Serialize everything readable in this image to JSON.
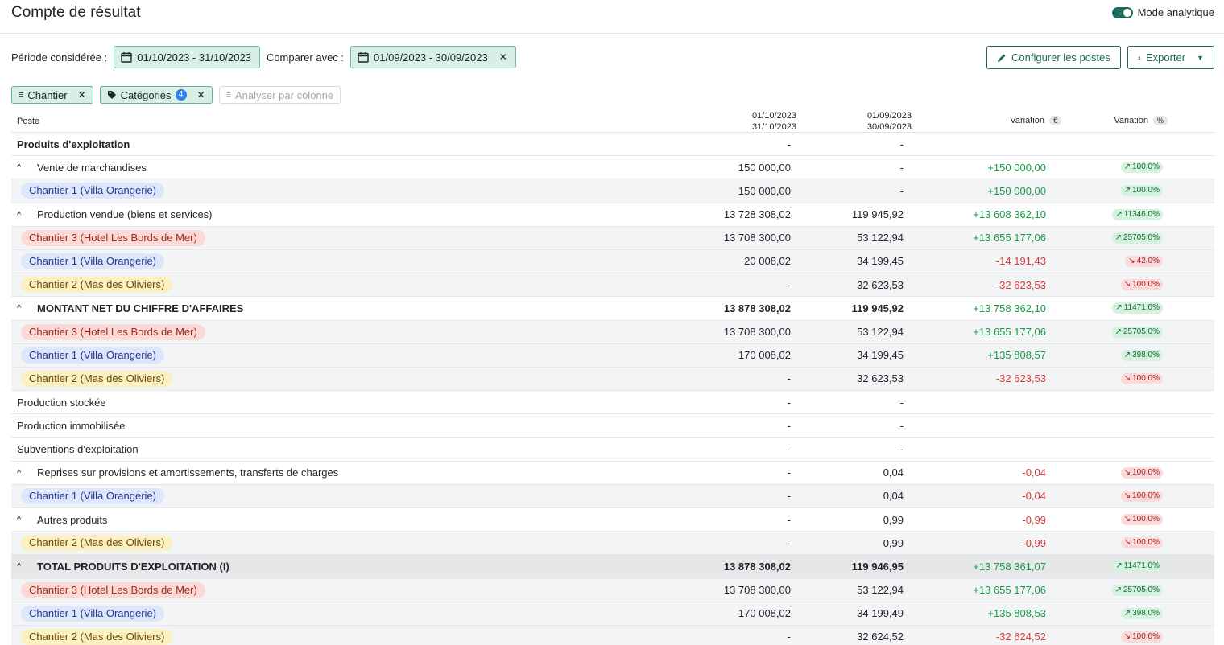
{
  "header": {
    "title": "Compte de résultat",
    "mode_label": "Mode analytique"
  },
  "filters": {
    "period_label": "Période considérée :",
    "period_value": "01/10/2023 - 31/10/2023",
    "compare_label": "Comparer avec :",
    "compare_value": "01/09/2023 - 30/09/2023"
  },
  "actions": {
    "configure_label": "Configurer les postes",
    "export_label": "Exporter"
  },
  "tags": {
    "chantier": "Chantier",
    "categories": "Catégories",
    "categories_count": "4",
    "analyse": "Analyser par colonne"
  },
  "table": {
    "headers": {
      "poste": "Poste",
      "d1_start": "01/10/2023",
      "d1_end": "31/10/2023",
      "d2_start": "01/09/2023",
      "d2_end": "30/09/2023",
      "variation": "Variation",
      "variation_unit": "€",
      "variation_pct": "Variation",
      "variation_pct_unit": "%"
    },
    "rows": [
      {
        "type": "section",
        "name": "Produits d'exploitation",
        "v1": "-",
        "v2": "-",
        "v3": "",
        "v4": ""
      },
      {
        "type": "group",
        "name": "Vente de marchandises",
        "v1": "150 000,00",
        "v2": "-",
        "v3": "+150 000,00",
        "v4": "100,0%",
        "dir": "up"
      },
      {
        "type": "sub",
        "chip": "c1",
        "name": "Chantier 1 (Villa Orangerie)",
        "v1": "150 000,00",
        "v2": "-",
        "v3": "+150 000,00",
        "v4": "100,0%",
        "dir": "up"
      },
      {
        "type": "group",
        "name": "Production vendue (biens et services)",
        "v1": "13 728 308,02",
        "v2": "119 945,92",
        "v3": "+13 608 362,10",
        "v4": "11346,0%",
        "dir": "up"
      },
      {
        "type": "sub",
        "chip": "c3",
        "name": "Chantier 3 (Hotel Les Bords de Mer)",
        "v1": "13 708 300,00",
        "v2": "53 122,94",
        "v3": "+13 655 177,06",
        "v4": "25705,0%",
        "dir": "up"
      },
      {
        "type": "sub",
        "chip": "c1",
        "name": "Chantier 1 (Villa Orangerie)",
        "v1": "20 008,02",
        "v2": "34 199,45",
        "v3": "-14 191,43",
        "v4": "42,0%",
        "dir": "down"
      },
      {
        "type": "sub",
        "chip": "c2",
        "name": "Chantier 2 (Mas des Oliviers)",
        "v1": "-",
        "v2": "32 623,53",
        "v3": "-32 623,53",
        "v4": "100,0%",
        "dir": "down"
      },
      {
        "type": "group",
        "bold": true,
        "name": "MONTANT NET DU CHIFFRE D'AFFAIRES",
        "v1": "13 878 308,02",
        "v2": "119 945,92",
        "v3": "+13 758 362,10",
        "v4": "11471,0%",
        "dir": "up"
      },
      {
        "type": "sub",
        "chip": "c3",
        "name": "Chantier 3 (Hotel Les Bords de Mer)",
        "v1": "13 708 300,00",
        "v2": "53 122,94",
        "v3": "+13 655 177,06",
        "v4": "25705,0%",
        "dir": "up"
      },
      {
        "type": "sub",
        "chip": "c1",
        "name": "Chantier 1 (Villa Orangerie)",
        "v1": "170 008,02",
        "v2": "34 199,45",
        "v3": "+135 808,57",
        "v4": "398,0%",
        "dir": "up"
      },
      {
        "type": "sub",
        "chip": "c2",
        "name": "Chantier 2 (Mas des Oliviers)",
        "v1": "-",
        "v2": "32 623,53",
        "v3": "-32 623,53",
        "v4": "100,0%",
        "dir": "down"
      },
      {
        "type": "plain",
        "name": "Production stockée",
        "v1": "-",
        "v2": "-",
        "v3": "",
        "v4": ""
      },
      {
        "type": "plain",
        "name": "Production immobilisée",
        "v1": "-",
        "v2": "-",
        "v3": "",
        "v4": ""
      },
      {
        "type": "plain",
        "name": "Subventions d'exploitation",
        "v1": "-",
        "v2": "-",
        "v3": "",
        "v4": ""
      },
      {
        "type": "group",
        "name": "Reprises sur provisions et amortissements, transferts de charges",
        "v1": "-",
        "v2": "0,04",
        "v3": "-0,04",
        "v4": "100,0%",
        "dir": "down"
      },
      {
        "type": "sub",
        "chip": "c1",
        "name": "Chantier 1 (Villa Orangerie)",
        "v1": "-",
        "v2": "0,04",
        "v3": "-0,04",
        "v4": "100,0%",
        "dir": "down"
      },
      {
        "type": "group",
        "name": "Autres produits",
        "v1": "-",
        "v2": "0,99",
        "v3": "-0,99",
        "v4": "100,0%",
        "dir": "down"
      },
      {
        "type": "sub",
        "chip": "c2",
        "name": "Chantier 2 (Mas des Oliviers)",
        "v1": "-",
        "v2": "0,99",
        "v3": "-0,99",
        "v4": "100,0%",
        "dir": "down"
      },
      {
        "type": "total",
        "bold": true,
        "name": "TOTAL PRODUITS D'EXPLOITATION (I)",
        "v1": "13 878 308,02",
        "v2": "119 946,95",
        "v3": "+13 758 361,07",
        "v4": "11471,0%",
        "dir": "up"
      },
      {
        "type": "sub",
        "chip": "c3",
        "name": "Chantier 3 (Hotel Les Bords de Mer)",
        "v1": "13 708 300,00",
        "v2": "53 122,94",
        "v3": "+13 655 177,06",
        "v4": "25705,0%",
        "dir": "up"
      },
      {
        "type": "sub",
        "chip": "c1",
        "name": "Chantier 1 (Villa Orangerie)",
        "v1": "170 008,02",
        "v2": "34 199,49",
        "v3": "+135 808,53",
        "v4": "398,0%",
        "dir": "up"
      },
      {
        "type": "sub",
        "chip": "c2",
        "name": "Chantier 2 (Mas des Oliviers)",
        "v1": "-",
        "v2": "32 624,52",
        "v3": "-32 624,52",
        "v4": "100,0%",
        "dir": "down"
      }
    ]
  }
}
